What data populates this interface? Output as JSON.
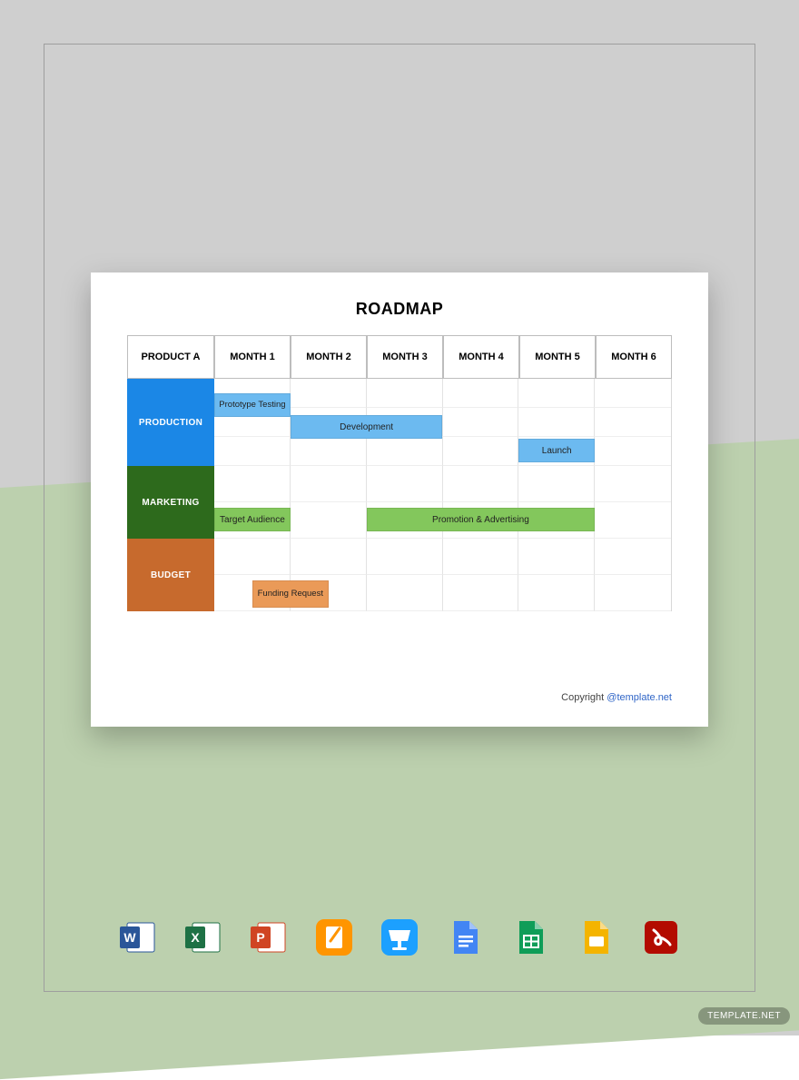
{
  "watermark": "TEMPLATE.NET",
  "card": {
    "title": "ROADMAP",
    "corner_label": "PRODUCT A",
    "months": [
      "MONTH 1",
      "MONTH 2",
      "MONTH 3",
      "MONTH 4",
      "MONTH 5",
      "MONTH 6"
    ],
    "rows": [
      {
        "label": "PRODUCTION",
        "color": "#1b87e6"
      },
      {
        "label": "MARKETING",
        "color": "#2d6a1c"
      },
      {
        "label": "BUDGET",
        "color": "#c76a2d"
      }
    ],
    "copyright_prefix": "Copyright ",
    "copyright_link": "@template.net"
  },
  "chart_data": {
    "type": "bar",
    "title": "ROADMAP",
    "xlabel": "",
    "ylabel": "",
    "categories": [
      "MONTH 1",
      "MONTH 2",
      "MONTH 3",
      "MONTH 4",
      "MONTH 5",
      "MONTH 6"
    ],
    "series": [
      {
        "name": "PRODUCTION",
        "color": "#5cb3ee",
        "bars": [
          {
            "label": "Prototype Testing",
            "start": 1,
            "span": 1
          },
          {
            "label": "Development",
            "start": 2,
            "span": 2
          },
          {
            "label": "Launch",
            "start": 5,
            "span": 1
          }
        ]
      },
      {
        "name": "MARKETING",
        "color": "#7cc24a",
        "bars": [
          {
            "label": "Target Audience",
            "start": 1,
            "span": 1
          },
          {
            "label": "Promotion & Advertising",
            "start": 3,
            "span": 3
          }
        ]
      },
      {
        "name": "BUDGET",
        "color": "#e6904a",
        "bars": [
          {
            "label": "Funding Request",
            "start": 1.5,
            "span": 1
          }
        ]
      }
    ]
  },
  "icons": [
    {
      "name": "word-icon"
    },
    {
      "name": "excel-icon"
    },
    {
      "name": "powerpoint-icon"
    },
    {
      "name": "pages-icon"
    },
    {
      "name": "keynote-icon"
    },
    {
      "name": "google-docs-icon"
    },
    {
      "name": "google-sheets-icon"
    },
    {
      "name": "google-slides-icon"
    },
    {
      "name": "pdf-icon"
    }
  ]
}
